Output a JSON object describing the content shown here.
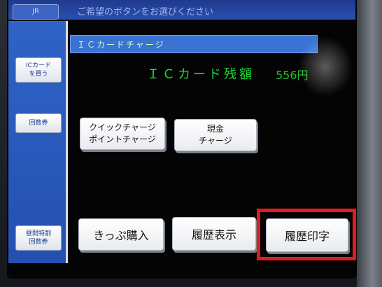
{
  "header": {
    "logo": "JR",
    "prompt": "ご希望のボタンをお選びください"
  },
  "sidebar": {
    "items": [
      {
        "label": "ICカード\nを買う"
      },
      {
        "label": "回数券"
      },
      {
        "label": "昼間特割\n回数券"
      }
    ]
  },
  "main": {
    "section_title": "ＩＣカードチャージ",
    "balance_label": "ＩＣカード残額",
    "balance_amount": "556円",
    "buttons": {
      "quick_charge": "クイックチャージ\nポイントチャージ",
      "cash_charge": "現金\nチャージ",
      "ticket_purchase": "きっぷ購入",
      "history_display": "履歴表示",
      "history_print": "履歴印字"
    }
  },
  "colors": {
    "sidebar": "#2a5abd",
    "section_bar": "#3a73d4",
    "balance_text": "#19e031",
    "highlight": "#e21a20"
  }
}
